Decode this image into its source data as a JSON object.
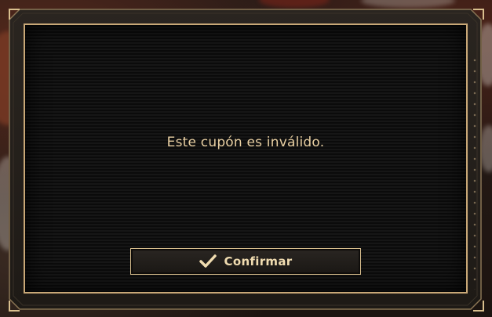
{
  "dialog": {
    "message": "Este cupón es inválido.",
    "confirm_label": "Confirmar",
    "confirm_icon": "checkmark-icon"
  },
  "colors": {
    "accent_gold": "#d9bf8e",
    "text_gold": "#e8cfa2",
    "panel_bg": "#0b0b0b",
    "frame_bg": "#2a2520"
  }
}
